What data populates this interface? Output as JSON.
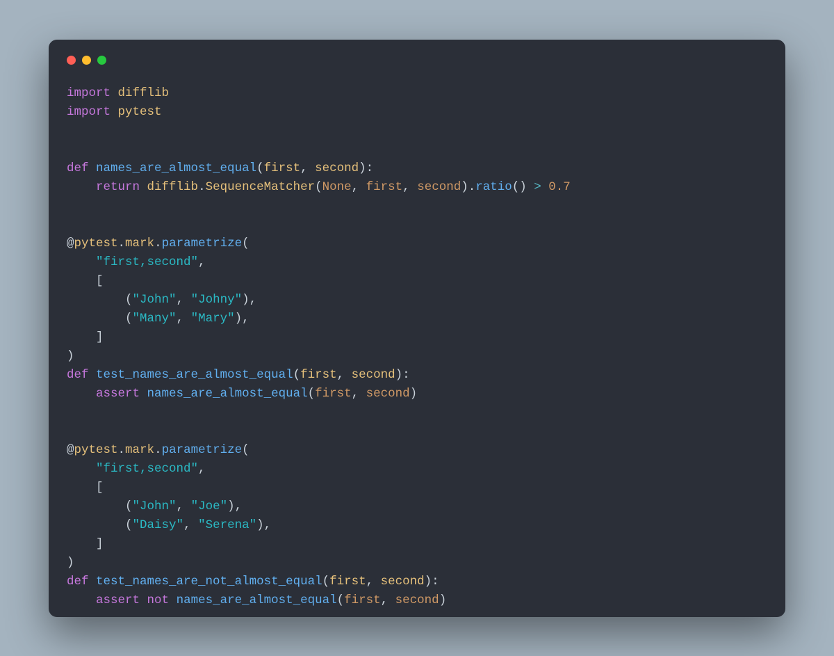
{
  "code": {
    "lines": [
      [
        {
          "cls": "tk-kw",
          "text": "import"
        },
        {
          "cls": "",
          "text": " "
        },
        {
          "cls": "tk-mod",
          "text": "difflib"
        }
      ],
      [
        {
          "cls": "tk-kw",
          "text": "import"
        },
        {
          "cls": "",
          "text": " "
        },
        {
          "cls": "tk-mod",
          "text": "pytest"
        }
      ],
      [],
      [],
      [
        {
          "cls": "tk-kw",
          "text": "def"
        },
        {
          "cls": "",
          "text": " "
        },
        {
          "cls": "tk-fn",
          "text": "names_are_almost_equal"
        },
        {
          "cls": "tk-punc",
          "text": "("
        },
        {
          "cls": "tk-param",
          "text": "first"
        },
        {
          "cls": "tk-punc",
          "text": ", "
        },
        {
          "cls": "tk-param",
          "text": "second"
        },
        {
          "cls": "tk-punc",
          "text": "):"
        }
      ],
      [
        {
          "cls": "",
          "text": "    "
        },
        {
          "cls": "tk-kw",
          "text": "return"
        },
        {
          "cls": "",
          "text": " "
        },
        {
          "cls": "tk-mod",
          "text": "difflib"
        },
        {
          "cls": "tk-punc",
          "text": "."
        },
        {
          "cls": "tk-mod",
          "text": "SequenceMatcher"
        },
        {
          "cls": "tk-punc",
          "text": "("
        },
        {
          "cls": "tk-none",
          "text": "None"
        },
        {
          "cls": "tk-punc",
          "text": ", "
        },
        {
          "cls": "tk-arg",
          "text": "first"
        },
        {
          "cls": "tk-punc",
          "text": ", "
        },
        {
          "cls": "tk-arg",
          "text": "second"
        },
        {
          "cls": "tk-punc",
          "text": ")."
        },
        {
          "cls": "tk-call",
          "text": "ratio"
        },
        {
          "cls": "tk-punc",
          "text": "() "
        },
        {
          "cls": "tk-op",
          "text": ">"
        },
        {
          "cls": "",
          "text": " "
        },
        {
          "cls": "tk-num",
          "text": "0.7"
        }
      ],
      [],
      [],
      [
        {
          "cls": "tk-at",
          "text": "@"
        },
        {
          "cls": "tk-dec",
          "text": "pytest"
        },
        {
          "cls": "tk-punc",
          "text": "."
        },
        {
          "cls": "tk-dec",
          "text": "mark"
        },
        {
          "cls": "tk-punc",
          "text": "."
        },
        {
          "cls": "tk-call",
          "text": "parametrize"
        },
        {
          "cls": "tk-punc",
          "text": "("
        }
      ],
      [
        {
          "cls": "",
          "text": "    "
        },
        {
          "cls": "tk-str",
          "text": "\"first,second\""
        },
        {
          "cls": "tk-punc",
          "text": ","
        }
      ],
      [
        {
          "cls": "",
          "text": "    "
        },
        {
          "cls": "tk-punc",
          "text": "["
        }
      ],
      [
        {
          "cls": "",
          "text": "        "
        },
        {
          "cls": "tk-punc",
          "text": "("
        },
        {
          "cls": "tk-str",
          "text": "\"John\""
        },
        {
          "cls": "tk-punc",
          "text": ", "
        },
        {
          "cls": "tk-str",
          "text": "\"Johny\""
        },
        {
          "cls": "tk-punc",
          "text": "),"
        }
      ],
      [
        {
          "cls": "",
          "text": "        "
        },
        {
          "cls": "tk-punc",
          "text": "("
        },
        {
          "cls": "tk-str",
          "text": "\"Many\""
        },
        {
          "cls": "tk-punc",
          "text": ", "
        },
        {
          "cls": "tk-str",
          "text": "\"Mary\""
        },
        {
          "cls": "tk-punc",
          "text": "),"
        }
      ],
      [
        {
          "cls": "",
          "text": "    "
        },
        {
          "cls": "tk-punc",
          "text": "]"
        }
      ],
      [
        {
          "cls": "tk-punc",
          "text": ")"
        }
      ],
      [
        {
          "cls": "tk-kw",
          "text": "def"
        },
        {
          "cls": "",
          "text": " "
        },
        {
          "cls": "tk-fn",
          "text": "test_names_are_almost_equal"
        },
        {
          "cls": "tk-punc",
          "text": "("
        },
        {
          "cls": "tk-param",
          "text": "first"
        },
        {
          "cls": "tk-punc",
          "text": ", "
        },
        {
          "cls": "tk-param",
          "text": "second"
        },
        {
          "cls": "tk-punc",
          "text": "):"
        }
      ],
      [
        {
          "cls": "",
          "text": "    "
        },
        {
          "cls": "tk-kw",
          "text": "assert"
        },
        {
          "cls": "",
          "text": " "
        },
        {
          "cls": "tk-fn",
          "text": "names_are_almost_equal"
        },
        {
          "cls": "tk-punc",
          "text": "("
        },
        {
          "cls": "tk-arg",
          "text": "first"
        },
        {
          "cls": "tk-punc",
          "text": ", "
        },
        {
          "cls": "tk-arg",
          "text": "second"
        },
        {
          "cls": "tk-punc",
          "text": ")"
        }
      ],
      [],
      [],
      [
        {
          "cls": "tk-at",
          "text": "@"
        },
        {
          "cls": "tk-dec",
          "text": "pytest"
        },
        {
          "cls": "tk-punc",
          "text": "."
        },
        {
          "cls": "tk-dec",
          "text": "mark"
        },
        {
          "cls": "tk-punc",
          "text": "."
        },
        {
          "cls": "tk-call",
          "text": "parametrize"
        },
        {
          "cls": "tk-punc",
          "text": "("
        }
      ],
      [
        {
          "cls": "",
          "text": "    "
        },
        {
          "cls": "tk-str",
          "text": "\"first,second\""
        },
        {
          "cls": "tk-punc",
          "text": ","
        }
      ],
      [
        {
          "cls": "",
          "text": "    "
        },
        {
          "cls": "tk-punc",
          "text": "["
        }
      ],
      [
        {
          "cls": "",
          "text": "        "
        },
        {
          "cls": "tk-punc",
          "text": "("
        },
        {
          "cls": "tk-str",
          "text": "\"John\""
        },
        {
          "cls": "tk-punc",
          "text": ", "
        },
        {
          "cls": "tk-str",
          "text": "\"Joe\""
        },
        {
          "cls": "tk-punc",
          "text": "),"
        }
      ],
      [
        {
          "cls": "",
          "text": "        "
        },
        {
          "cls": "tk-punc",
          "text": "("
        },
        {
          "cls": "tk-str",
          "text": "\"Daisy\""
        },
        {
          "cls": "tk-punc",
          "text": ", "
        },
        {
          "cls": "tk-str",
          "text": "\"Serena\""
        },
        {
          "cls": "tk-punc",
          "text": "),"
        }
      ],
      [
        {
          "cls": "",
          "text": "    "
        },
        {
          "cls": "tk-punc",
          "text": "]"
        }
      ],
      [
        {
          "cls": "tk-punc",
          "text": ")"
        }
      ],
      [
        {
          "cls": "tk-kw",
          "text": "def"
        },
        {
          "cls": "",
          "text": " "
        },
        {
          "cls": "tk-fn",
          "text": "test_names_are_not_almost_equal"
        },
        {
          "cls": "tk-punc",
          "text": "("
        },
        {
          "cls": "tk-param",
          "text": "first"
        },
        {
          "cls": "tk-punc",
          "text": ", "
        },
        {
          "cls": "tk-param",
          "text": "second"
        },
        {
          "cls": "tk-punc",
          "text": "):"
        }
      ],
      [
        {
          "cls": "",
          "text": "    "
        },
        {
          "cls": "tk-kw",
          "text": "assert"
        },
        {
          "cls": "",
          "text": " "
        },
        {
          "cls": "tk-kw",
          "text": "not"
        },
        {
          "cls": "",
          "text": " "
        },
        {
          "cls": "tk-fn",
          "text": "names_are_almost_equal"
        },
        {
          "cls": "tk-punc",
          "text": "("
        },
        {
          "cls": "tk-arg",
          "text": "first"
        },
        {
          "cls": "tk-punc",
          "text": ", "
        },
        {
          "cls": "tk-arg",
          "text": "second"
        },
        {
          "cls": "tk-punc",
          "text": ")"
        }
      ]
    ]
  }
}
